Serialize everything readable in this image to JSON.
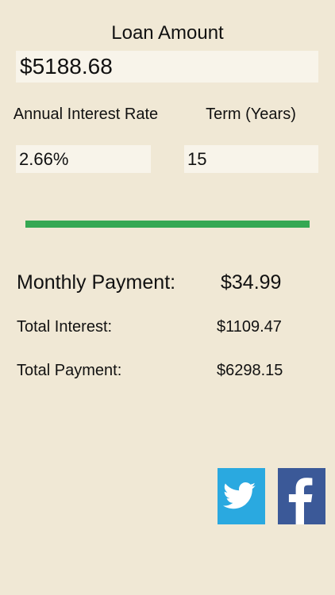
{
  "loan": {
    "title": "Loan Amount",
    "amount_value": "$5188.68"
  },
  "rate": {
    "label": "Annual Interest Rate",
    "value": "2.66%"
  },
  "term": {
    "label": "Term (Years)",
    "value": "15"
  },
  "progress": {
    "fraction": 1.0,
    "color": "#35a853"
  },
  "results": {
    "monthly_label": "Monthly Payment:",
    "monthly_value": "$34.99",
    "interest_label": "Total Interest:",
    "interest_value": "$1109.47",
    "payment_label": "Total Payment:",
    "payment_value": "$6298.15"
  },
  "social": {
    "twitter_icon": "twitter-bird-icon",
    "twitter_color": "#2aa9e0",
    "facebook_icon": "facebook-f-icon",
    "facebook_color": "#3b5998"
  },
  "colors": {
    "background": "#f0e8d5",
    "field_background": "#f8f4ea"
  }
}
